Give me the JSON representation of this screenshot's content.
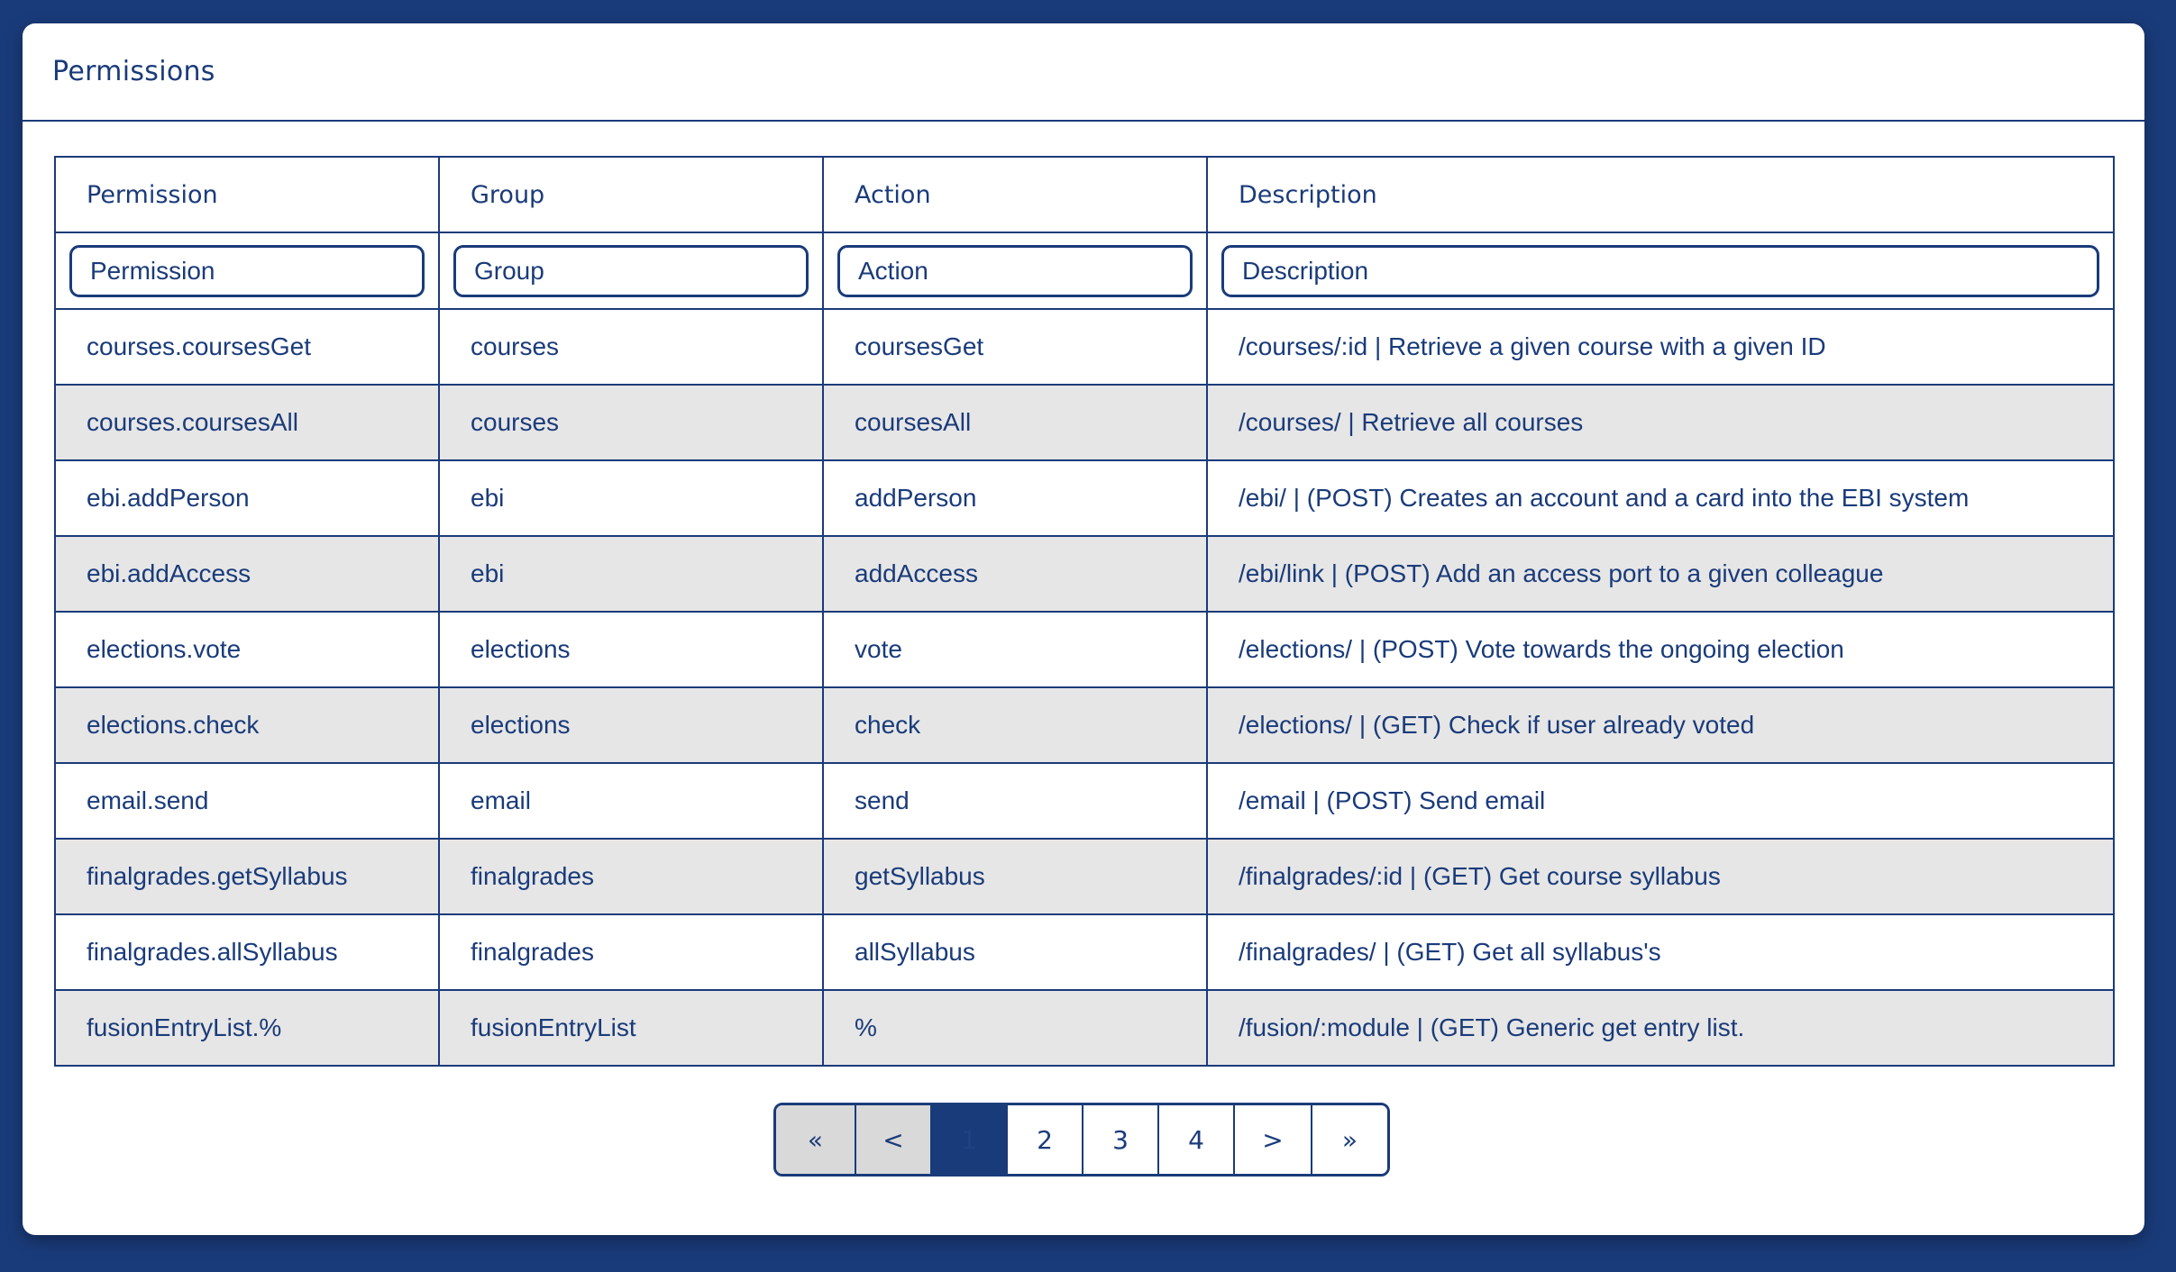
{
  "panel": {
    "title": "Permissions"
  },
  "table": {
    "columns": [
      "Permission",
      "Group",
      "Action",
      "Description"
    ],
    "filters": [
      {
        "placeholder": "Permission",
        "value": ""
      },
      {
        "placeholder": "Group",
        "value": ""
      },
      {
        "placeholder": "Action",
        "value": ""
      },
      {
        "placeholder": "Description",
        "value": ""
      }
    ],
    "rows": [
      [
        "courses.coursesGet",
        "courses",
        "coursesGet",
        "/courses/:id | Retrieve a given course with a given ID"
      ],
      [
        "courses.coursesAll",
        "courses",
        "coursesAll",
        "/courses/ | Retrieve all courses"
      ],
      [
        "ebi.addPerson",
        "ebi",
        "addPerson",
        "/ebi/ | (POST) Creates an account and a card into the EBI system"
      ],
      [
        "ebi.addAccess",
        "ebi",
        "addAccess",
        "/ebi/link | (POST) Add an access port to a given colleague"
      ],
      [
        "elections.vote",
        "elections",
        "vote",
        "/elections/ | (POST) Vote towards the ongoing election"
      ],
      [
        "elections.check",
        "elections",
        "check",
        "/elections/ | (GET) Check if user already voted"
      ],
      [
        "email.send",
        "email",
        "send",
        "/email | (POST) Send email"
      ],
      [
        "finalgrades.getSyllabus",
        "finalgrades",
        "getSyllabus",
        "/finalgrades/:id | (GET) Get course syllabus"
      ],
      [
        "finalgrades.allSyllabus",
        "finalgrades",
        "allSyllabus",
        "/finalgrades/ | (GET) Get all syllabus's"
      ],
      [
        "fusionEntryList.%",
        "fusionEntryList",
        "%",
        "/fusion/:module | (GET) Generic get entry list."
      ]
    ]
  },
  "pagination": {
    "first": "«",
    "prev": "<",
    "pages": [
      "1",
      "2",
      "3",
      "4"
    ],
    "current_page": "1",
    "next": ">",
    "last": "»"
  },
  "colors": {
    "primary": "#1a3b7a",
    "background": "#1a3b7a",
    "striped_row": "#e6e6e6",
    "disabled_button": "#d9d9d9"
  }
}
